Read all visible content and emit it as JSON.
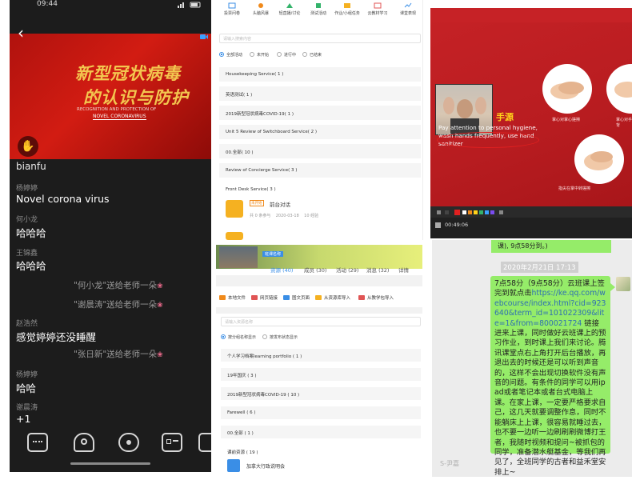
{
  "live_class": {
    "status_time": "09:44",
    "slide_title_line1": "新型冠状病毒",
    "slide_title_line2": "的认识与防护",
    "slide_subtitle": "RECOGNITION AND PROTECTION OF",
    "slide_subtitle2": "NOVEL CORONAVIRUS",
    "chat": [
      {
        "type": "msg",
        "name": "",
        "text": "bianfu"
      },
      {
        "type": "msg",
        "name": "杨婷婷",
        "text": "Novel corona virus"
      },
      {
        "type": "msg",
        "name": "何小龙",
        "text": "哈哈哈"
      },
      {
        "type": "msg",
        "name": "王锦鑫",
        "text": "哈哈哈"
      },
      {
        "type": "gift",
        "text": "\"何小龙\"送给老师一朵"
      },
      {
        "type": "gift",
        "text": "\"谢晨涛\"送给老师一朵"
      },
      {
        "type": "msg",
        "name": "赵浩然",
        "text": "感觉婷婷还没睡醒"
      },
      {
        "type": "gift",
        "text": "\"张日新\"送给老师一朵"
      },
      {
        "type": "msg",
        "name": "杨婷婷",
        "text": "哈哈"
      },
      {
        "type": "msg",
        "name": "谢晨涛",
        "text": "+1"
      }
    ]
  },
  "course_panel": {
    "nav": [
      "投票问卷",
      "头脑风暴",
      "轻直播/讨论",
      "测试活动",
      "作业/小组任务",
      "云教材学习",
      "课堂表现"
    ],
    "search_placeholder": "请输入搜索内容",
    "filters": [
      "全部活动",
      "未开始",
      "进行中",
      "已结束"
    ],
    "modules": [
      "Housekeeping Service( 1 )",
      "英语测试( 1 )",
      "2019新型冠状病毒COVID-19( 1 )",
      "Unit 5 Review of Switchboard Service( 2 )",
      "00.全部( 10 )",
      "Review of Concierge Service( 3 )",
      "Front  Desk Service( 3 )"
    ],
    "activity": {
      "tag": "未开始",
      "title": "前台对话",
      "meta": "共 0 条参与    2020-03-18    10 经验"
    }
  },
  "slide_panel": {
    "title": "手源",
    "caption": "Pay attention to personal hygiene, wash hands frequently, use hand sanitizer",
    "labels": [
      "掌心对掌心搓擦",
      "掌心对手背",
      "掌心对掌心搓擦",
      "指尖在掌中转搓擦"
    ],
    "time": "00:49:06"
  },
  "resource_panel": {
    "banner_text": "班课名称",
    "tabs": [
      "资源 (40)",
      "成员 (30)",
      "活动 (29)",
      "消息 (32)",
      "详情"
    ],
    "tools": [
      "本地文件",
      "网页链接",
      "图文页面",
      "从资源库导入",
      "从教学包导入"
    ],
    "search_placeholder": "请输入资源名称",
    "sort_options": [
      "按分组名称显示",
      "按发布状态显示"
    ],
    "rows": [
      "个人学习档案learning portfolio ( 1 )",
      "19年国庆 ( 3 )",
      "2019新型冠状病毒COVID-19 ( 10 )",
      "Farewell ( 6 )",
      "00.全部 ( 1 )",
      "课前资源 ( 19 )"
    ],
    "last_item": "加拿大行政说明会"
  },
  "message_panel": {
    "top_text": "课),   9点58分到。)",
    "time": "2020年2月21日 17:13",
    "text_before_link": "7点58分（9点58分）云班课上签完到就点击",
    "link": "https://ke.qq.com/webcourse/index.html?cid=923640&term_id=101022309&lite=1&from=800021724",
    "text_after_link": " 链接进来上课，同时做好云班课上的预习作业，到时课上我们来讨论。腾讯课堂点右上角打开后台播放，再退出去的时候还是可以听到声音的，这样不会出现切换软件没有声音的问题。有条件的同学可以用ipad或者笔记本或者台式电脑上课。在家上课，一定要严格要求自己，这几天就要调整作息，同时不能躺床上上课，很容易就睡过去，也不要一边听一边刷刷刷微博打王者，我随时视频和提问~被抓包的同学，准备潜水艇基金，等我们再见了，全班同学的古者和益禾堂安排上~",
    "footer": "S-尹嘉"
  }
}
